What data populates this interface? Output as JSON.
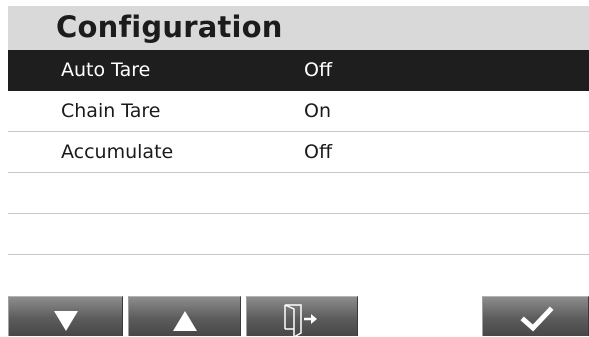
{
  "header": {
    "title": "Configuration"
  },
  "settings": [
    {
      "label": "Auto Tare",
      "value": "Off",
      "selected": true
    },
    {
      "label": "Chain Tare",
      "value": "On",
      "selected": false
    },
    {
      "label": "Accumulate",
      "value": "Off",
      "selected": false
    }
  ],
  "empty_rows": 3,
  "softkeys": [
    {
      "icon": "arrow-down-icon"
    },
    {
      "icon": "arrow-up-icon"
    },
    {
      "icon": "exit-door-icon"
    },
    {
      "icon": "checkmark-icon"
    }
  ],
  "colors": {
    "header_bg": "#d9d9d9",
    "selected_row_bg": "#1e1e1e",
    "softkey_bg": "#5c5c5c"
  }
}
